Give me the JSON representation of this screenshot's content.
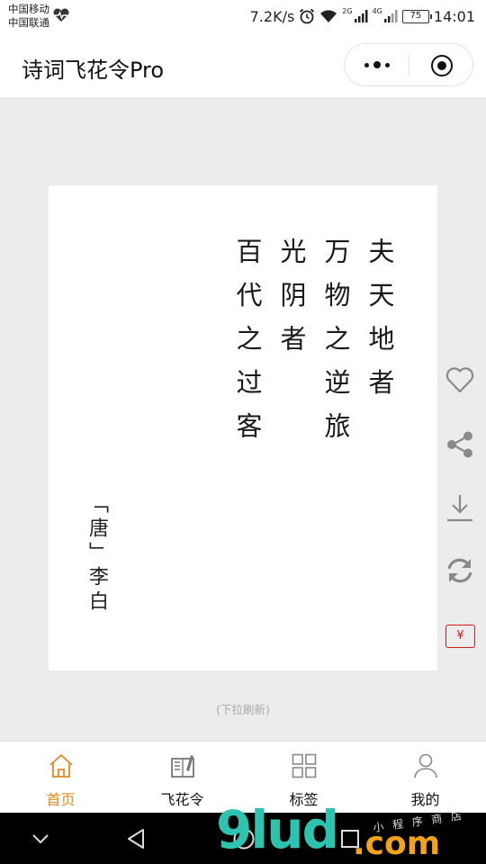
{
  "status_bar": {
    "carrier_1": "中国移动",
    "carrier_2": "中国联通",
    "net_speed": "7.2K/s",
    "net_2g": "2G",
    "net_4g": "4G",
    "battery": "75",
    "time": "14:01"
  },
  "app": {
    "title": "诗词飞花令Pro"
  },
  "poem": {
    "lines": [
      "夫天地者",
      "万物之逆旅",
      "光阴者",
      "百代之过客"
    ],
    "attribution": "「唐」李白"
  },
  "side_actions": [
    {
      "name": "heart-icon"
    },
    {
      "name": "share-icon"
    },
    {
      "name": "download-icon"
    },
    {
      "name": "refresh-icon"
    },
    {
      "name": "yen-icon",
      "label": "¥"
    }
  ],
  "pull_hint": "(下拉刷新)",
  "tabs": [
    {
      "label": "首页",
      "icon": "home-icon",
      "active": true
    },
    {
      "label": "飞花令",
      "icon": "book-pen-icon",
      "active": false
    },
    {
      "label": "标签",
      "icon": "grid-icon",
      "active": false
    },
    {
      "label": "我的",
      "icon": "user-icon",
      "active": false
    }
  ],
  "colors": {
    "accent": "#e08a1e",
    "background": "#ececec",
    "yen_red": "#d21c1c"
  },
  "watermark": {
    "text": "9lud",
    "suffix": ".com",
    "small": "小 程 序 商 店"
  }
}
